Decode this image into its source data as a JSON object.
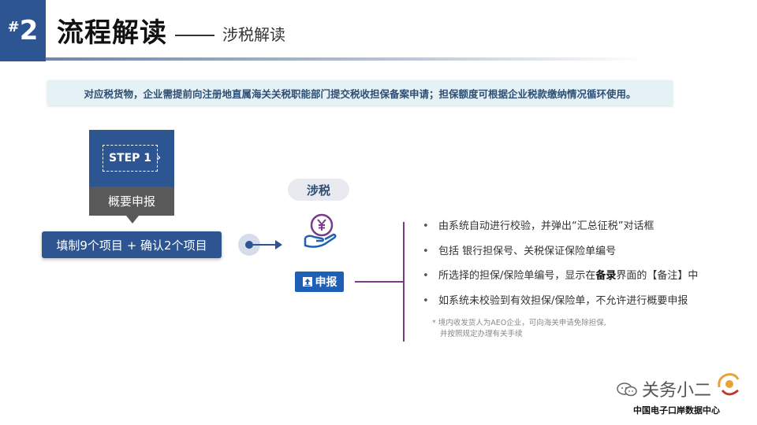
{
  "header": {
    "hash": "#",
    "number": "2",
    "title": "流程解读",
    "subtitle": "涉税解读"
  },
  "notice": "对应税货物，企业需提前向注册地直属海关关税职能部门提交税收担保备案申请；担保额度可根据企业税款缴纳情况循环使用。",
  "step": {
    "label": "STEP 1",
    "name": "概要申报",
    "fill_text": "填制9个项目 + 确认2个项目"
  },
  "tax": {
    "pill": "涉税",
    "icon": "yen-hand-icon",
    "declare_label": "申报"
  },
  "bullets": [
    {
      "pre": "由系统自动进行校验，并弹出“汇总征税”对话框",
      "bold": "",
      "post": ""
    },
    {
      "pre": "包括 银行担保号、关税保证保险单编号",
      "bold": "",
      "post": ""
    },
    {
      "pre": "所选择的担保/保险单编号，显示在",
      "bold": "备录",
      "post": "界面的【备注】中"
    },
    {
      "pre": "如系统未校验到有效担保/保险单，不允许进行概要申报",
      "bold": "",
      "post": ""
    }
  ],
  "footnote": {
    "line1": "* 境内收发货人为AEO企业，可向海关申请免除担保,",
    "line2": "并按照规定办理有关手续"
  },
  "watermark": {
    "name": "关务小二",
    "sub": "中国电子口岸数据中心"
  },
  "colors": {
    "primary": "#2C5592",
    "gray": "#595959",
    "bracket": "#7b3b8a",
    "notice_bg": "#e6f1f6",
    "gold": "#e8a23a"
  }
}
